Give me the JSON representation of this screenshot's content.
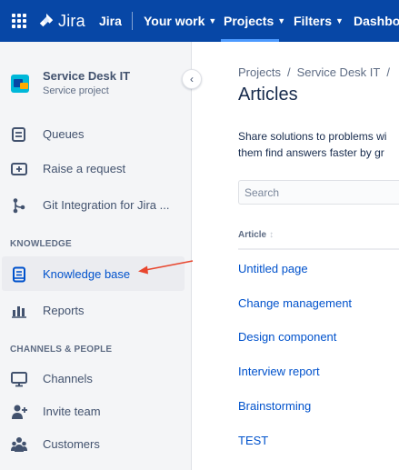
{
  "topnav": {
    "app_name": "Jira",
    "items": [
      {
        "label": "Jira"
      },
      {
        "label": "Your work"
      },
      {
        "label": "Projects"
      },
      {
        "label": "Filters"
      },
      {
        "label": "Dashboa"
      }
    ]
  },
  "sidebar": {
    "project": {
      "name": "Service Desk IT",
      "type": "Service project"
    },
    "items": [
      {
        "label": "Queues",
        "icon": "queues-icon"
      },
      {
        "label": "Raise a request",
        "icon": "raise-request-icon"
      },
      {
        "label": "Git Integration for Jira ...",
        "icon": "git-integration-icon"
      }
    ],
    "knowledge_heading": "KNOWLEDGE",
    "knowledge_items": [
      {
        "label": "Knowledge base",
        "icon": "knowledge-base-icon",
        "selected": true
      },
      {
        "label": "Reports",
        "icon": "reports-icon"
      }
    ],
    "channels_heading": "CHANNELS & PEOPLE",
    "channel_items": [
      {
        "label": "Channels",
        "icon": "channels-icon"
      },
      {
        "label": "Invite team",
        "icon": "invite-team-icon"
      },
      {
        "label": "Customers",
        "icon": "customers-icon"
      }
    ]
  },
  "main": {
    "breadcrumb": [
      "Projects",
      "Service Desk IT"
    ],
    "title": "Articles",
    "description_line1": "Share solutions to problems wi",
    "description_line2": "them find answers faster by gr",
    "search_placeholder": "Search",
    "column_header": "Article",
    "articles": [
      "Untitled page",
      "Change management",
      "Design component",
      "Interview report",
      "Brainstorming",
      "TEST"
    ]
  },
  "colors": {
    "nav_bg": "#0747a6",
    "sidebar_bg": "#f4f5f7",
    "link": "#0052cc",
    "annotation_arrow": "#e8462e"
  }
}
